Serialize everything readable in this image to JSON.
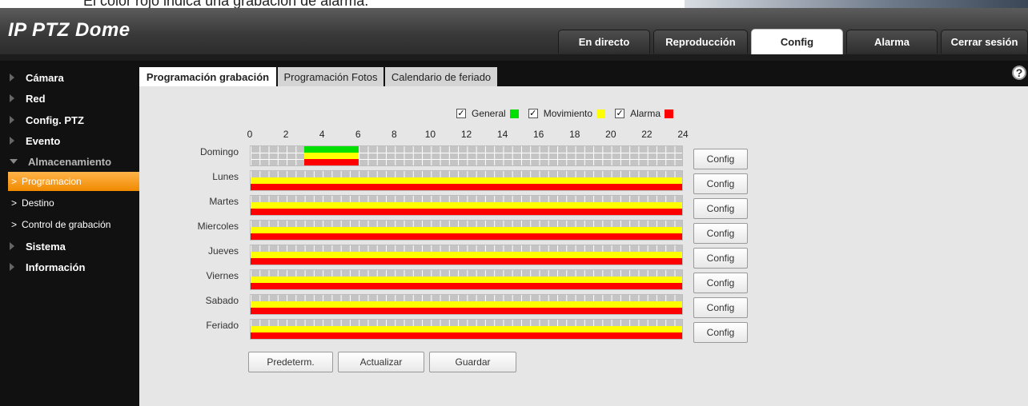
{
  "doc_caption": "El color rojo indica una grabación de alarma.",
  "header": {
    "brand": "IP PTZ Dome",
    "tabs": [
      {
        "label": "En directo"
      },
      {
        "label": "Reproducción"
      },
      {
        "label": "Config",
        "active": true
      },
      {
        "label": "Alarma"
      },
      {
        "label": "Cerrar sesión"
      }
    ]
  },
  "sidebar": {
    "items": [
      {
        "label": "Cámara"
      },
      {
        "label": "Red"
      },
      {
        "label": "Config. PTZ"
      },
      {
        "label": "Evento"
      },
      {
        "label": "Almacenamiento",
        "expanded": true
      },
      {
        "label": "Programacion",
        "sub": true,
        "active": true
      },
      {
        "label": "Destino",
        "sub": true
      },
      {
        "label": "Control de grabación",
        "sub": true
      },
      {
        "label": "Sistema"
      },
      {
        "label": "Información"
      }
    ]
  },
  "subtabs": [
    {
      "label": "Programación grabación",
      "active": true
    },
    {
      "label": "Programación Fotos"
    },
    {
      "label": "Calendario de feriado"
    }
  ],
  "help_icon": "?",
  "legend": [
    {
      "label": "General",
      "checked": true,
      "color": "#00e000"
    },
    {
      "label": "Movimiento",
      "checked": true,
      "color": "#ffff00"
    },
    {
      "label": "Alarma",
      "checked": true,
      "color": "#ff0000"
    }
  ],
  "hours": [
    "0",
    "2",
    "4",
    "6",
    "8",
    "10",
    "12",
    "14",
    "16",
    "18",
    "20",
    "22",
    "24"
  ],
  "schedule": [
    {
      "day": "Domingo",
      "general": [
        [
          3,
          6
        ]
      ],
      "movimiento": [
        [
          3,
          6
        ]
      ],
      "alarma": [
        [
          3,
          6
        ]
      ]
    },
    {
      "day": "Lunes",
      "general": [],
      "movimiento": [
        [
          0,
          24
        ]
      ],
      "alarma": [
        [
          0,
          24
        ]
      ]
    },
    {
      "day": "Martes",
      "general": [],
      "movimiento": [
        [
          0,
          24
        ]
      ],
      "alarma": [
        [
          0,
          24
        ]
      ]
    },
    {
      "day": "Miercoles",
      "general": [],
      "movimiento": [
        [
          0,
          24
        ]
      ],
      "alarma": [
        [
          0,
          24
        ]
      ]
    },
    {
      "day": "Jueves",
      "general": [],
      "movimiento": [
        [
          0,
          24
        ]
      ],
      "alarma": [
        [
          0,
          24
        ]
      ]
    },
    {
      "day": "Viernes",
      "general": [],
      "movimiento": [
        [
          0,
          24
        ]
      ],
      "alarma": [
        [
          0,
          24
        ]
      ]
    },
    {
      "day": "Sabado",
      "general": [],
      "movimiento": [
        [
          0,
          24
        ]
      ],
      "alarma": [
        [
          0,
          24
        ]
      ]
    },
    {
      "day": "Feriado",
      "general": [],
      "movimiento": [
        [
          0,
          24
        ]
      ],
      "alarma": [
        [
          0,
          24
        ]
      ]
    }
  ],
  "config_label": "Config",
  "actions": {
    "default_label": "Predeterm.",
    "refresh_label": "Actualizar",
    "save_label": "Guardar"
  }
}
